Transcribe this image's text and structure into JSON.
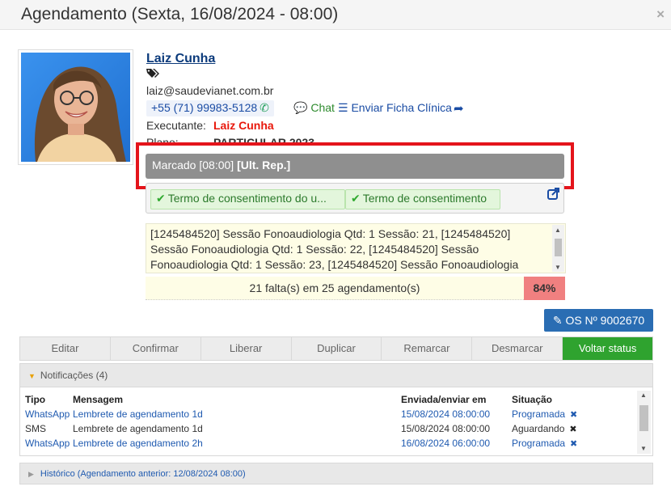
{
  "header": {
    "title": "Agendamento (Sexta, 16/08/2024 - 08:00)",
    "close": "×"
  },
  "patient": {
    "name": "Laiz Cunha",
    "email": "laiz@saudevianet.com.br",
    "phone": "+55 (71) 99983-5128",
    "chat_label": "Chat",
    "ficha_label": "Enviar Ficha Clínica"
  },
  "executante": {
    "label": "Executante:",
    "value": "Laiz Cunha"
  },
  "plano": {
    "label": "Plano:",
    "value": "PARTICULAR 2023"
  },
  "status": {
    "text": "Marcado [08:00]",
    "bold": "[Ult. Rep.]"
  },
  "terms": [
    {
      "label": "Termo de consentimento do u..."
    },
    {
      "label": "Termo de consentimento"
    }
  ],
  "sessions_text": "[1245484520] Sessão Fonoaudiologia Qtd: 1 Sessão: 21, [1245484520] Sessão Fonoaudiologia Qtd: 1 Sessão: 22, [1245484520] Sessão Fonoaudiologia Qtd: 1 Sessão: 23, [1245484520] Sessão Fonoaudiologia",
  "faltas": {
    "text": "21 falta(s) em 25 agendamento(s)",
    "percent": "84%"
  },
  "os_button": "OS Nº 9002670",
  "actions": [
    "Editar",
    "Confirmar",
    "Liberar",
    "Duplicar",
    "Remarcar",
    "Desmarcar",
    "Voltar status"
  ],
  "notifications": {
    "title": "Notificações (4)",
    "headers": {
      "tipo": "Tipo",
      "mensagem": "Mensagem",
      "enviada": "Enviada/enviar em",
      "situacao": "Situação"
    },
    "rows": [
      {
        "tipo": "WhatsApp",
        "mensagem": "Lembrete de agendamento 1d",
        "enviada": "15/08/2024 08:00:00",
        "situacao": "Programada"
      },
      {
        "tipo": "SMS",
        "mensagem": "Lembrete de agendamento 1d",
        "enviada": "15/08/2024 08:00:00",
        "situacao": "Aguardando"
      },
      {
        "tipo": "WhatsApp",
        "mensagem": "Lembrete de agendamento 2h",
        "enviada": "16/08/2024 06:00:00",
        "situacao": "Programada"
      }
    ]
  },
  "historico": "Histórico (Agendamento anterior: 12/08/2024 08:00)",
  "colors": {
    "accent": "#2a6db3",
    "success": "#2fa32f",
    "danger": "#e4141b",
    "status_gray": "#8f8f8f"
  }
}
